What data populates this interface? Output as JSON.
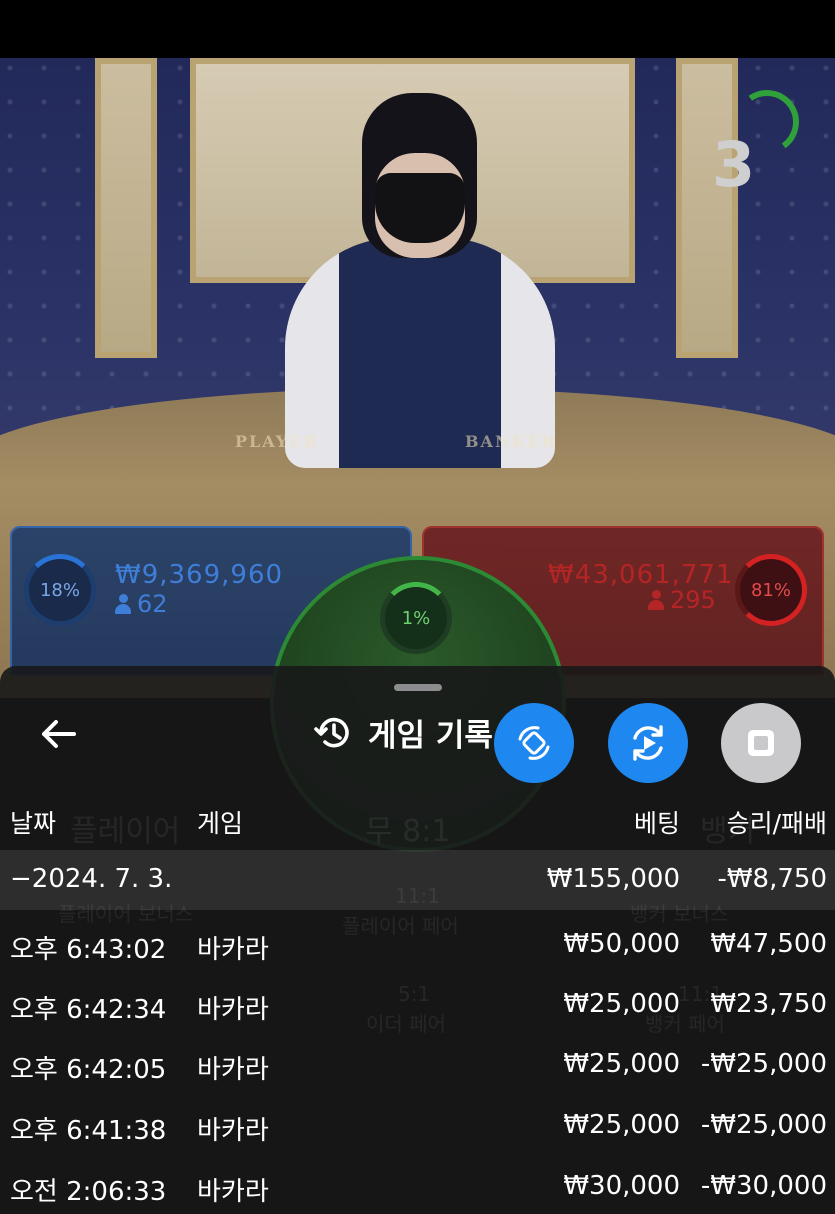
{
  "stream": {
    "countdown": "3",
    "table_labels": {
      "player": "PLAYER",
      "banker": "BANKER"
    }
  },
  "bets": {
    "player": {
      "percent": "18%",
      "amount": "₩9,369,960",
      "players": "62"
    },
    "banker": {
      "percent": "81%",
      "amount": "₩43,061,771",
      "players": "295"
    },
    "tie": {
      "percent": "1%"
    }
  },
  "background_labels": {
    "player": "플레이어",
    "tie": "무 8:1",
    "banker": "뱅커",
    "player_bonus": "플레이어 보너스",
    "player_pair_odds": "11:1",
    "player_pair": "플레이어 페어",
    "banker_bonus": "뱅커 보너스",
    "either_pair_odds": "5:1",
    "either_pair": "이더 페어",
    "banker_pair_odds": "11:1",
    "banker_pair": "뱅커 페어"
  },
  "history": {
    "title": "게임 기록",
    "columns": {
      "date": "날짜",
      "game": "게임",
      "bet": "베팅",
      "result": "승리/패배"
    },
    "date_row": {
      "date": "−2024. 7. 3.",
      "bet": "₩155,000",
      "result": "-₩8,750"
    },
    "rows": [
      {
        "time": "오후 6:43:02",
        "game": "바카라",
        "bet": "₩50,000",
        "result": "₩47,500"
      },
      {
        "time": "오후 6:42:34",
        "game": "바카라",
        "bet": "₩25,000",
        "result": "₩23,750"
      },
      {
        "time": "오후 6:42:05",
        "game": "바카라",
        "bet": "₩25,000",
        "result": "-₩25,000"
      },
      {
        "time": "오후 6:41:38",
        "game": "바카라",
        "bet": "₩25,000",
        "result": "-₩25,000"
      },
      {
        "time": "오전 2:06:33",
        "game": "바카라",
        "bet": "₩30,000",
        "result": "-₩30,000"
      }
    ]
  },
  "icons": {
    "back": "arrow-left-icon",
    "history": "history-clock-icon",
    "fab_one": "rotate-screen-icon",
    "fab_two": "replay-play-icon",
    "fab_three": "stop-icon"
  },
  "colors": {
    "fab_blue": "#1f87f0",
    "fab_gray": "#c9c9cc",
    "player": "#3f7ed8",
    "banker": "#b52525",
    "tie": "#2c8a34"
  }
}
